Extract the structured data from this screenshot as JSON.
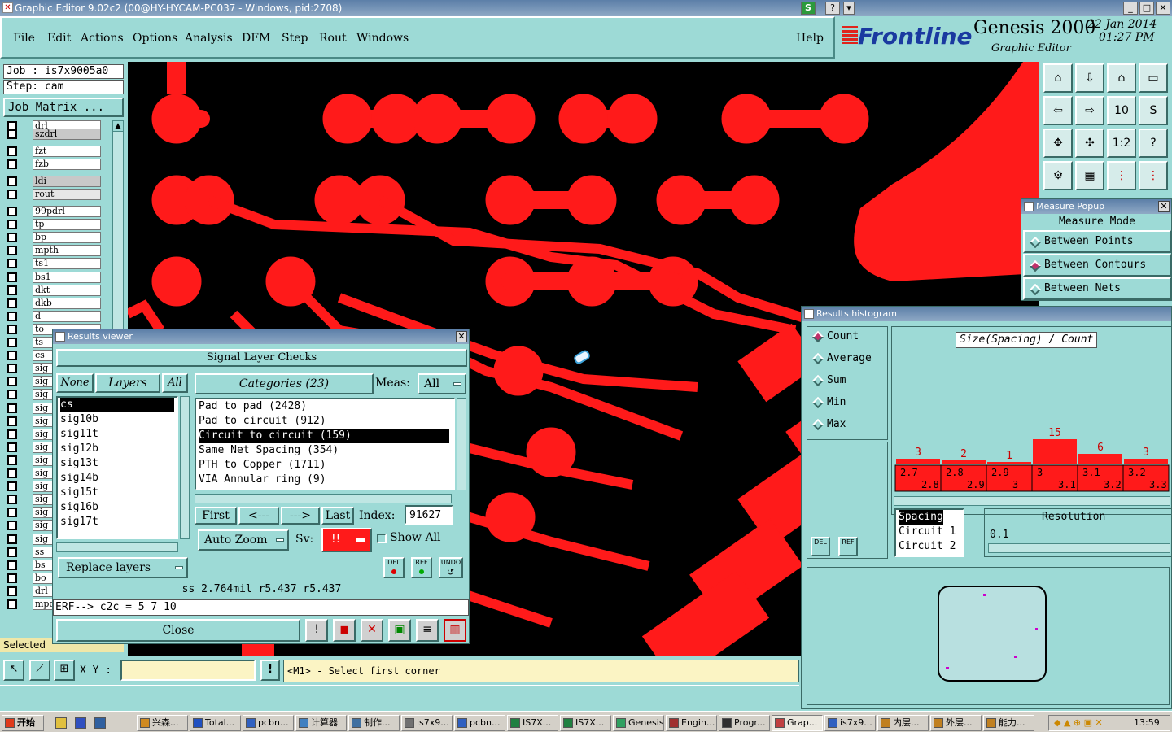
{
  "window": {
    "title": "Graphic Editor 9.02c2 (00@HY-HYCAM-PC037 - Windows, pid:2708)",
    "s_badge": "S",
    "help_q": "?",
    "minimize": "_",
    "maximize": "□",
    "close": "✕"
  },
  "menu": {
    "items": [
      "File",
      "Edit",
      "Actions",
      "Options",
      "Analysis",
      "DFM",
      "Step",
      "Rout",
      "Windows"
    ],
    "help": "Help"
  },
  "brand": {
    "logo": "Frontline",
    "product": "Genesis 2000",
    "subtitle": "Graphic Editor",
    "date": "22 Jan 2014",
    "time": "01:27 PM"
  },
  "left": {
    "job": "Job : is7x9005a0",
    "step": "Step: cam",
    "job_matrix": "Job Matrix ...",
    "layers_top": [
      "drl",
      "szdrl"
    ],
    "layers_mid": [
      "fzt",
      "fzb"
    ],
    "layers_mid2": [
      "ldi",
      "rout"
    ],
    "layers": [
      "99pdrl",
      "tp",
      "bp",
      "mpth",
      "ts1",
      "bs1",
      "dkt",
      "dkb",
      "d",
      "to",
      "ts",
      "cs",
      "sig",
      "sig",
      "sig",
      "sig",
      "sig",
      "sig",
      "sig",
      "sig",
      "sig",
      "sig",
      "sig",
      "sig",
      "sig",
      "sig",
      "ss",
      "bs",
      "bo",
      "drl",
      "mpd"
    ],
    "selected": "Selected"
  },
  "results_viewer": {
    "title": "Results viewer",
    "header": "Signal Layer Checks",
    "none_btn": "None",
    "layers_btn": "Layers",
    "all_btn": "All",
    "layer_list": [
      "cs",
      "sig10b",
      "sig11t",
      "sig12b",
      "sig13t",
      "sig14b",
      "sig15t",
      "sig16b",
      "sig17t"
    ],
    "categories_btn": "Categories (23)",
    "meas_label": "Meas:",
    "meas_value": "All",
    "categories": [
      "Pad to pad (2428)",
      "Pad to circuit (912)",
      "Circuit to circuit (159)",
      "Same Net Spacing (354)",
      "PTH to Copper (1711)",
      "VIA Annular ring (9)"
    ],
    "first": "First",
    "prev": "<---",
    "next": "--->",
    "last": "Last",
    "index_label": "Index:",
    "index_value": "91627",
    "auto_zoom": "Auto Zoom",
    "sv_label": "Sv:",
    "sv_value": "!!",
    "show_all": "Show All",
    "replace_layers": "Replace layers",
    "del": "DEL",
    "ref": "REF",
    "undo": "UNDO",
    "status": "ss 2.764mil  r5.437  r5.437",
    "erf": "ERF--> c2c = 5 7 10",
    "close": "Close"
  },
  "measure_popup": {
    "title": "Measure Popup",
    "mode": "Measure Mode",
    "options": [
      "Between Points",
      "Between Contours",
      "Between Nets"
    ],
    "selected_index": 1
  },
  "histogram": {
    "title": "Results histogram",
    "options": [
      "Count",
      "Average",
      "Sum",
      "Min",
      "Max"
    ],
    "chart_title": "Size(Spacing) / Count",
    "bins": [
      "2.7-2.8",
      "2.8-2.9",
      "2.9-3",
      "3-3.1",
      "3.1-3.2",
      "3.2-3.3"
    ],
    "counts": [
      3,
      2,
      1,
      15,
      6,
      3
    ],
    "del": "DEL",
    "ref": "REF",
    "list": [
      "Spacing",
      "Circuit 1",
      "Circuit 2"
    ],
    "resolution_label": "Resolution",
    "resolution_value": "0.1"
  },
  "bottom": {
    "xy_label": "X Y :",
    "xy_value": "",
    "info_btn": "!",
    "prompt": "<M1> - Select first corner"
  },
  "taskbar": {
    "start": "开始",
    "tasks": [
      "兴森...",
      "Total...",
      "pcbn...",
      "计算器",
      "制作...",
      "is7x9...",
      "pcbn...",
      "IS7X...",
      "IS7X...",
      "Genesis",
      "Engin...",
      "Progr...",
      "Grap...",
      "is7x9...",
      "内层...",
      "外层...",
      "能力..."
    ],
    "clock": "13:59"
  },
  "colors": {
    "copper": "#ff1a1a",
    "bg": "#000000",
    "panel": "#9ddad6",
    "accent": "#c0306a"
  }
}
